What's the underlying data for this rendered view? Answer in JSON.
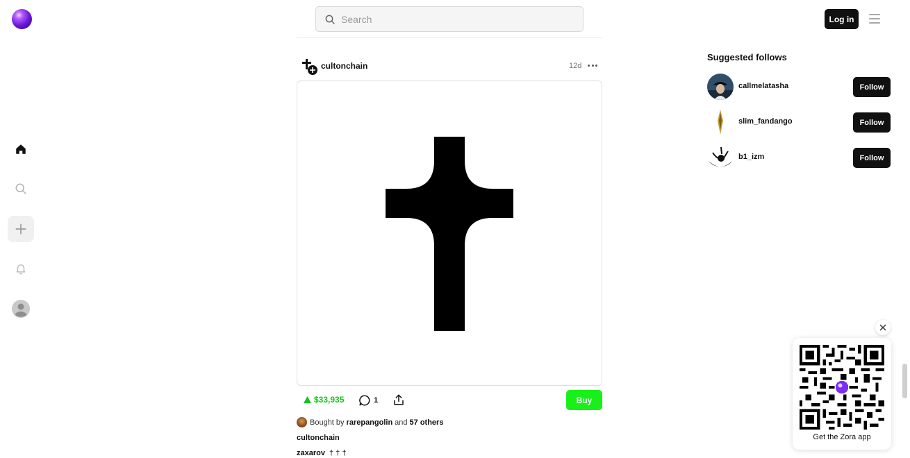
{
  "nav": {
    "items": [
      "home-icon",
      "search-icon",
      "plus-icon",
      "bell-icon",
      "profile-icon"
    ]
  },
  "search": {
    "placeholder": "Search"
  },
  "header": {
    "login_label": "Log in"
  },
  "post": {
    "author": "cultonchain",
    "time": "12d",
    "price": "$33,935",
    "comment_count": "1",
    "buy_label": "Buy",
    "bought_prefix": "Bought by",
    "bought_user": "rarepangolin",
    "bought_and": "and",
    "bought_others": "57 others",
    "caption_user": "cultonchain",
    "comment_user": "zaxarov",
    "comment_text": "† † †"
  },
  "suggested": {
    "title": "Suggested follows",
    "follow_label": "Follow",
    "users": [
      {
        "name": "callmelatasha"
      },
      {
        "name": "slim_fandango"
      },
      {
        "name": "b1_izm"
      }
    ]
  },
  "app_promo": {
    "label": "Get the Zora app"
  },
  "colors": {
    "accent_green": "#19f01a",
    "price_green": "#16c21b",
    "dark": "#111111"
  }
}
